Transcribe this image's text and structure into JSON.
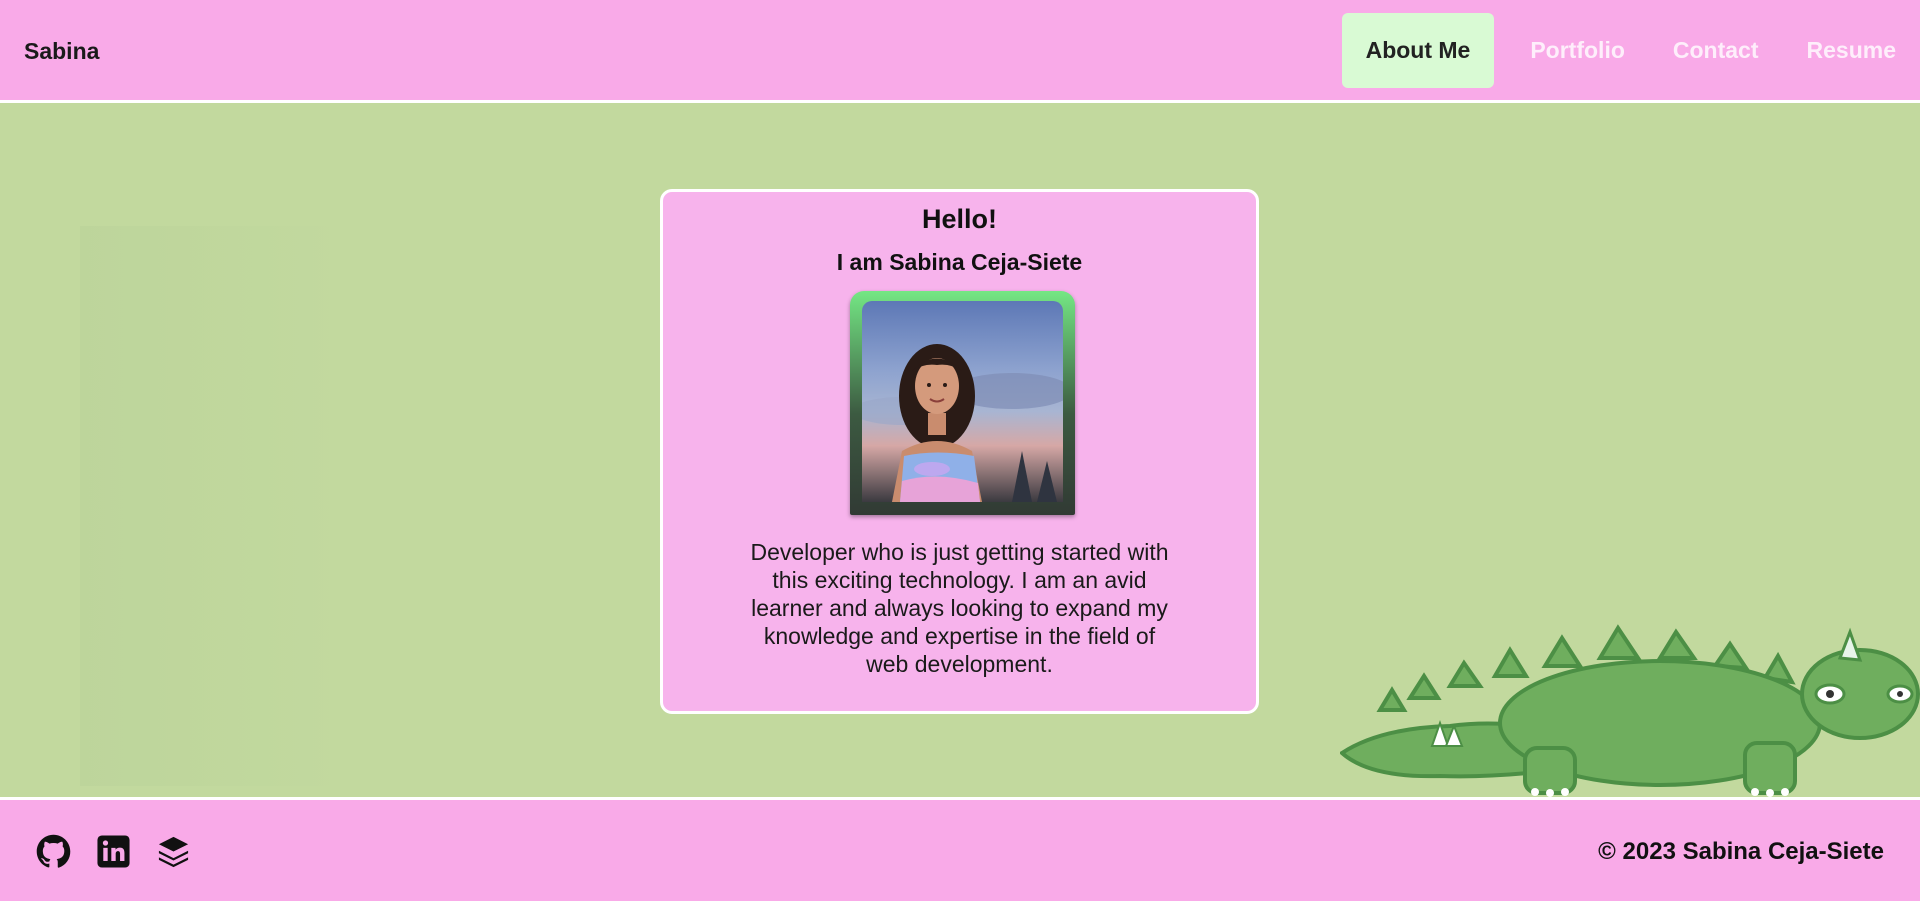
{
  "header": {
    "brand": "Sabina",
    "nav": [
      {
        "label": "About Me",
        "active": true
      },
      {
        "label": "Portfolio",
        "active": false
      },
      {
        "label": "Contact",
        "active": false
      },
      {
        "label": "Resume",
        "active": false
      }
    ]
  },
  "card": {
    "title": "Hello!",
    "subtitle": "I am Sabina Ceja-Siete",
    "description": "Developer who is just getting started with this exciting technology. I am an avid learner and always looking to expand my knowledge and expertise in the field of web development."
  },
  "footer": {
    "social_icons": [
      "github-icon",
      "linkedin-icon",
      "stack-icon"
    ],
    "copyright": "© 2023 Sabina Ceja-Siete"
  },
  "colors": {
    "header_bg": "#f9aae8",
    "page_bg": "#c2d99e",
    "card_bg": "#f7b3ec",
    "active_nav_bg": "#d9fad4",
    "dino_green": "#6fae5e"
  }
}
